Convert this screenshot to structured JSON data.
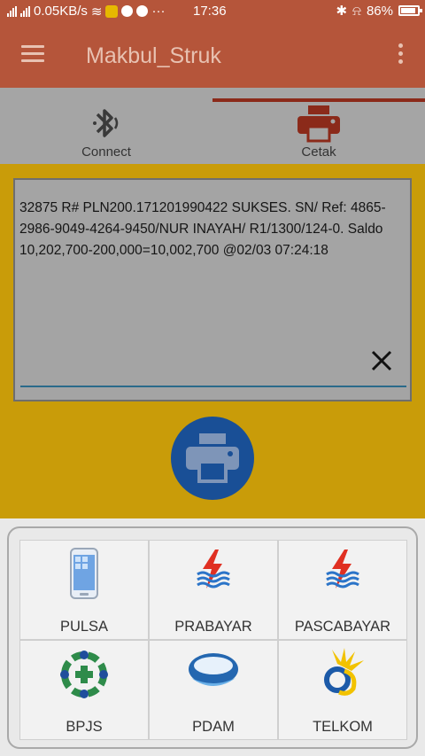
{
  "status_bar": {
    "network_speed": "0.05KB/s",
    "time": "17:36",
    "battery": "86%",
    "signal_icon": "signal-icon",
    "wifi_icon": "wifi-icon",
    "bluetooth_icon": "bluetooth-icon",
    "alarm_icon": "alarm-icon"
  },
  "toolbar": {
    "title": "Makbul_Struk",
    "menu_icon": "hamburger-icon",
    "overflow_icon": "more-vert-icon",
    "color": "#b5553a"
  },
  "tabs": [
    {
      "label": "Connect",
      "icon": "bluetooth-connect-icon",
      "selected": false
    },
    {
      "label": "Cetak",
      "icon": "printer-icon",
      "selected": true
    }
  ],
  "receipt": {
    "text": "32875 R#  PLN200.171201990422 SUKSES. SN/ Ref: 4865-2986-9049-4264-9450/NUR INAYAH/ R1/1300/124-0. Saldo 10,202,700-200,000=10,002,700 @02/03 07:24:18",
    "clear_icon": "close-icon"
  },
  "print_button": {
    "icon": "printer-icon",
    "color": "#194f96"
  },
  "menu": [
    {
      "label": "PULSA",
      "icon": "phone-icon"
    },
    {
      "label": "PRABAYAR",
      "icon": "pln-icon"
    },
    {
      "label": "PASCABAYAR",
      "icon": "pln-icon"
    },
    {
      "label": "BPJS",
      "icon": "bpjs-icon"
    },
    {
      "label": "PDAM",
      "icon": "pdam-icon"
    },
    {
      "label": "TELKOM",
      "icon": "telkom-icon"
    }
  ],
  "colors": {
    "accent": "#c99c09",
    "tab_bg": "#a5a5a5"
  }
}
